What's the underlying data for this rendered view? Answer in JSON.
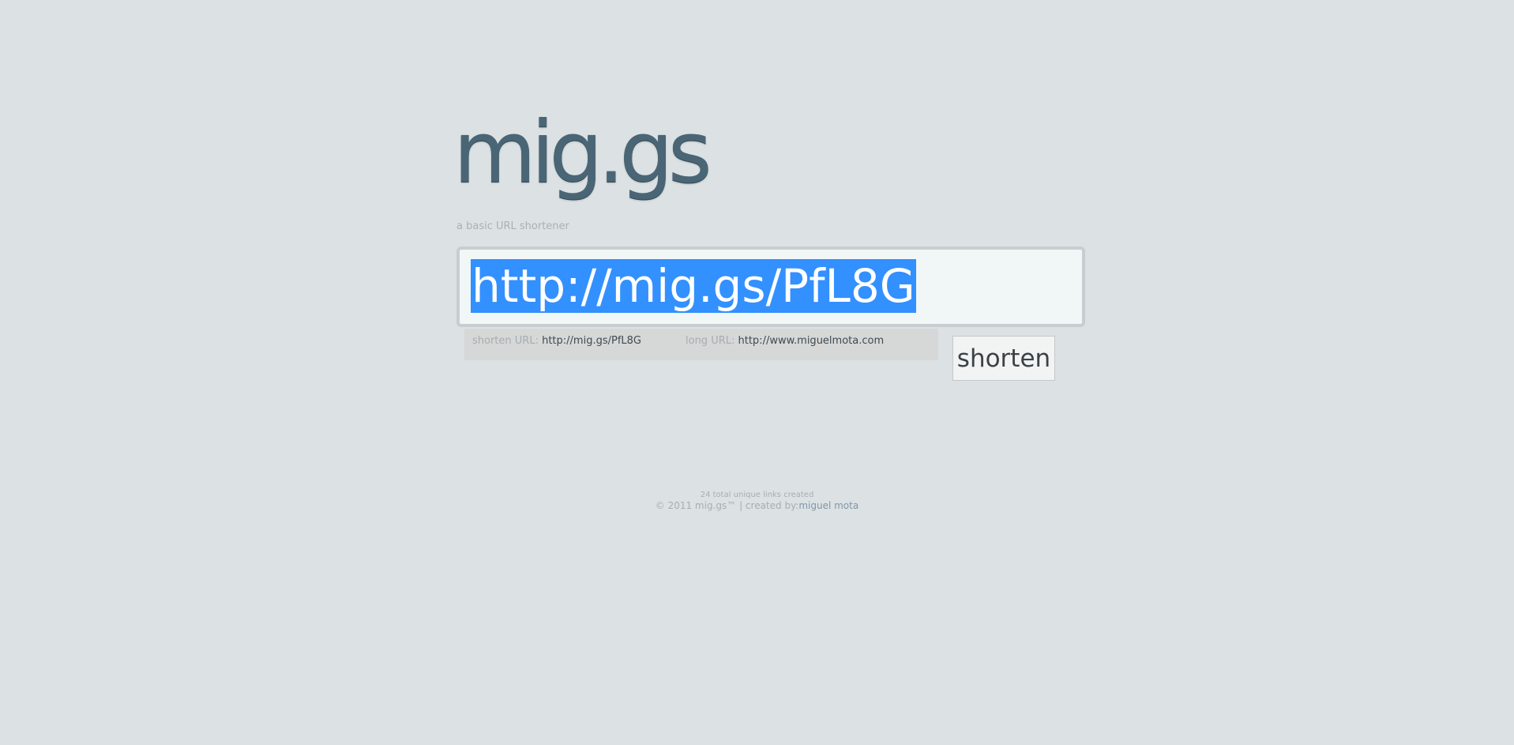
{
  "brand": {
    "logo_text": "mig.gs",
    "tagline": "a basic URL shortener"
  },
  "url_input": {
    "value": "http://mig.gs/PfL8G",
    "selected": true
  },
  "info": {
    "short_label": "shorten URL:",
    "short_value": "http://mig.gs/PfL8G",
    "long_label": "long URL:",
    "long_value": "http://www.miguelmota.com"
  },
  "actions": {
    "shorten_label": "shorten"
  },
  "footer": {
    "count_text": "24 total unique links created",
    "copyright_text": "© 2011 mig.gs™ | created by:",
    "author_link": "miguel mota"
  },
  "colors": {
    "background": "#dce1e4",
    "logo": "#4a6676",
    "input_background": "#f1f7f7",
    "selection": "#3390ff",
    "info_bar": "#d6d8d8",
    "link": "#7e98a8"
  }
}
